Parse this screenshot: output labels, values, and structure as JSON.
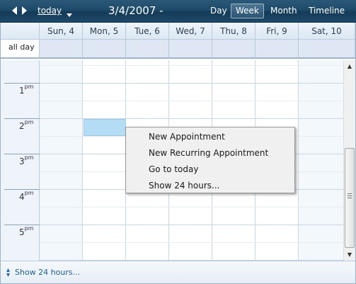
{
  "toolbar": {
    "prev_icon": "left-triangle",
    "next_icon": "right-triangle",
    "today_label": "today",
    "today_dropdown_icon": "down-triangle",
    "date_title": "3/4/2007 -",
    "views": [
      "Day",
      "Week",
      "Month",
      "Timeline"
    ],
    "active_view": "Week"
  },
  "calendar": {
    "days": [
      "Sun, 4",
      "Mon, 5",
      "Tue, 6",
      "Wed, 7",
      "Thu, 8",
      "Fri, 9",
      "Sat, 10"
    ],
    "all_day_label": "all day",
    "hours": [
      {
        "hour": "1",
        "suffix": "pm"
      },
      {
        "hour": "2",
        "suffix": "pm"
      },
      {
        "hour": "3",
        "suffix": "pm"
      },
      {
        "hour": "4",
        "suffix": "pm"
      },
      {
        "hour": "5",
        "suffix": "pm"
      }
    ],
    "selected_slot": {
      "day": "Mon, 5",
      "time": "2pm"
    }
  },
  "context_menu": {
    "items": [
      "New Appointment",
      "New Recurring Appointment",
      "Go to today",
      "Show 24 hours..."
    ]
  },
  "footer": {
    "icon": "expand-up-down-icon",
    "link_label": "Show 24 hours..."
  },
  "colors": {
    "toolbar_bg": "#1f4b6b",
    "selected_slot": "#b4dcf5",
    "all_day_row": "#dfe7f4",
    "link": "#1f5f9a"
  }
}
